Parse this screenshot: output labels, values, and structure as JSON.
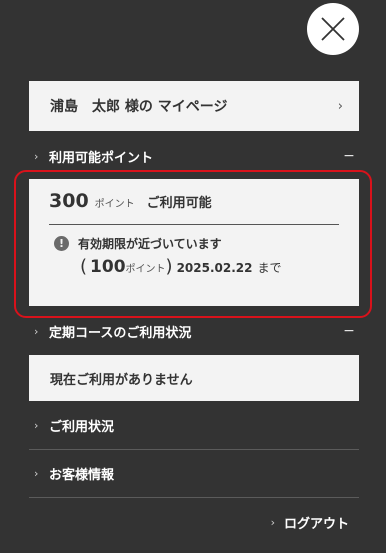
{
  "close": {
    "icon": "close-icon"
  },
  "mypage": {
    "label": "浦島　太郎 様の マイページ",
    "chevron": "›"
  },
  "points_section": {
    "header": "利用可能ポイント",
    "chevron": "›",
    "toggle": "−",
    "points_value": "300",
    "points_unit": "ポイント",
    "points_status": "ご利用可能",
    "notice_icon": "!",
    "notice_text": "有効期限が近づいています",
    "expire_open": "(",
    "expire_points": "100",
    "expire_unit": "ポイント",
    "expire_close": ")",
    "expire_date": "2025.02.22",
    "expire_suffix": "まで"
  },
  "course_section": {
    "header": "定期コースのご利用状況",
    "chevron": "›",
    "toggle": "−",
    "status": "現在ご利用がありません"
  },
  "nav": [
    {
      "label": "ご利用状況",
      "chevron": "›"
    },
    {
      "label": "お客様情報",
      "chevron": "›"
    }
  ],
  "logout": {
    "label": "ログアウト",
    "chevron": "›"
  },
  "colors": {
    "background": "#333333",
    "card": "#f3f3f3",
    "highlight": "#d9121b"
  }
}
